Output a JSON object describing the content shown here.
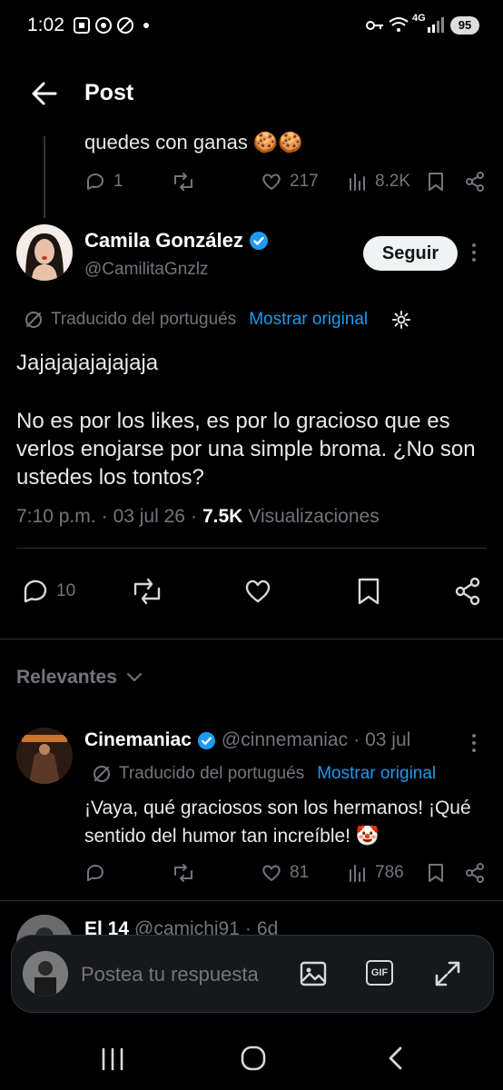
{
  "status_bar": {
    "time": "1:02",
    "network": "4G",
    "battery": "95"
  },
  "header": {
    "title": "Post"
  },
  "prev_reply": {
    "text_tail": "quedes con ganas 🍪🍪",
    "replies": "1",
    "likes": "217",
    "views": "8.2K"
  },
  "post": {
    "author_name": "Camila González",
    "handle": "@CamilitaGnzlz",
    "follow_label": "Seguir",
    "translated_label": "Traducido del portugués",
    "show_original": "Mostrar original",
    "text_line1": "Jajajajajajajaja",
    "text_body": "No es por los likes, es por lo gracioso que es verlos enojarse por una simple broma. ¿No son ustedes los tontos?",
    "time": "7:10 p.m.",
    "date": "03 jul 26",
    "views": "7.5K",
    "views_label": "Visualizaciones",
    "reply_count": "10"
  },
  "relevantes": {
    "label": "Relevantes"
  },
  "reply1": {
    "name": "Cinemaniac",
    "handle": "@cinnemaniac",
    "date": "03 jul",
    "translated_label": "Traducido del portugués",
    "show_original": "Mostrar original",
    "text": "¡Vaya, qué graciosos son los hermanos! ¡Qué sentido del humor tan increíble! 🤡",
    "likes": "81",
    "views": "786"
  },
  "reply2": {
    "name": "El 14",
    "handle": "@camichi91",
    "date": "6d"
  },
  "composer": {
    "placeholder": "Postea tu respuesta",
    "gif_label": "GIF"
  },
  "colors": {
    "accent": "#1d9bf0",
    "background": "#000000",
    "muted": "#71767b"
  }
}
